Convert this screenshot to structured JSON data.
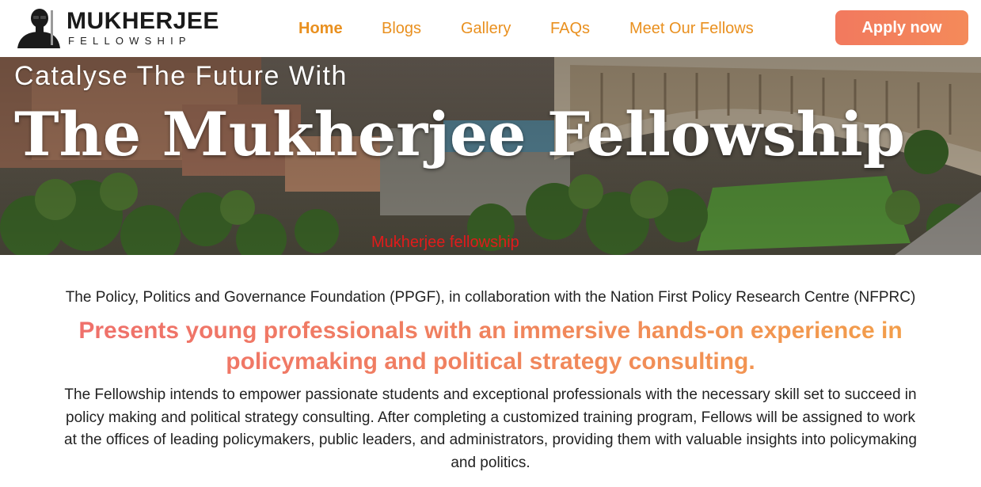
{
  "header": {
    "logo": {
      "word": "MUKHERJEE",
      "sub": "FELLOWSHIP",
      "icon": "silhouette-portrait-icon"
    },
    "nav": [
      {
        "label": "Home",
        "active": true
      },
      {
        "label": "Blogs",
        "active": false
      },
      {
        "label": "Gallery",
        "active": false
      },
      {
        "label": "FAQs",
        "active": false
      },
      {
        "label": "Meet Our Fellows",
        "active": false
      }
    ],
    "apply_label": "Apply now"
  },
  "hero": {
    "subtitle": "Catalyse The Future With",
    "title": "The Mukherjee Fellowship",
    "image_caption": "Mukherjee fellowship"
  },
  "content": {
    "intro": "The Policy, Politics and Governance Foundation (PPGF), in collaboration with the Nation First Policy Research Centre (NFPRC)",
    "tagline": "Presents young professionals with an immersive hands-on experience in policymaking and political strategy consulting.",
    "body": "The Fellowship intends to empower passionate students and exceptional professionals with the necessary skill set to succeed in policy making and political strategy consulting. After completing a customized training program, Fellows will be assigned to work at the offices of leading policymakers, public leaders, and administrators, providing them with valuable insights into policymaking and politics."
  },
  "colors": {
    "nav_text": "#e9901f",
    "apply_button": "#f2795e",
    "caption_text": "#e11b1b",
    "tagline_start": "#ef6f6c",
    "tagline_end": "#f3a049"
  }
}
